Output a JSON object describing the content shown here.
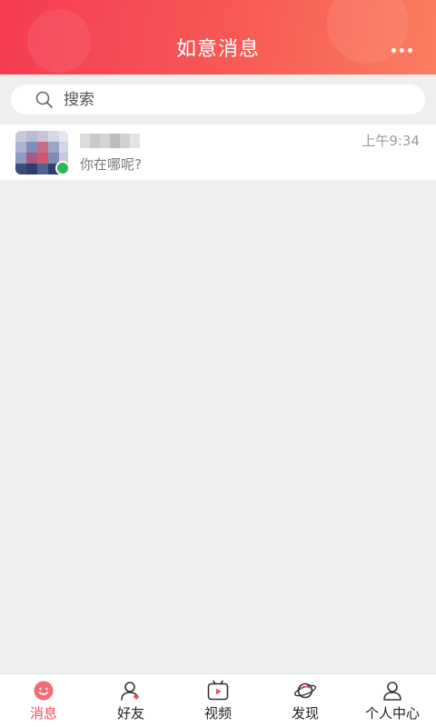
{
  "header": {
    "title": "如意消息",
    "more_icon": "more-dots-icon"
  },
  "search": {
    "placeholder": "搜索",
    "icon": "search-icon"
  },
  "conversations": [
    {
      "time": "上午9:34",
      "preview": "你在哪呢?",
      "online": true
    }
  ],
  "nav": {
    "items": [
      {
        "label": "消息",
        "icon": "message-smile-icon",
        "active": true
      },
      {
        "label": "好友",
        "icon": "friends-icon",
        "active": false
      },
      {
        "label": "视频",
        "icon": "video-icon",
        "active": false
      },
      {
        "label": "发现",
        "icon": "planet-icon",
        "active": false
      },
      {
        "label": "个人中心",
        "icon": "profile-icon",
        "active": false
      }
    ]
  },
  "colors": {
    "header_start": "#f53b52",
    "header_end": "#fb7e60",
    "accent": "#f24d5a",
    "online": "#2fb657",
    "background": "#efefef"
  }
}
